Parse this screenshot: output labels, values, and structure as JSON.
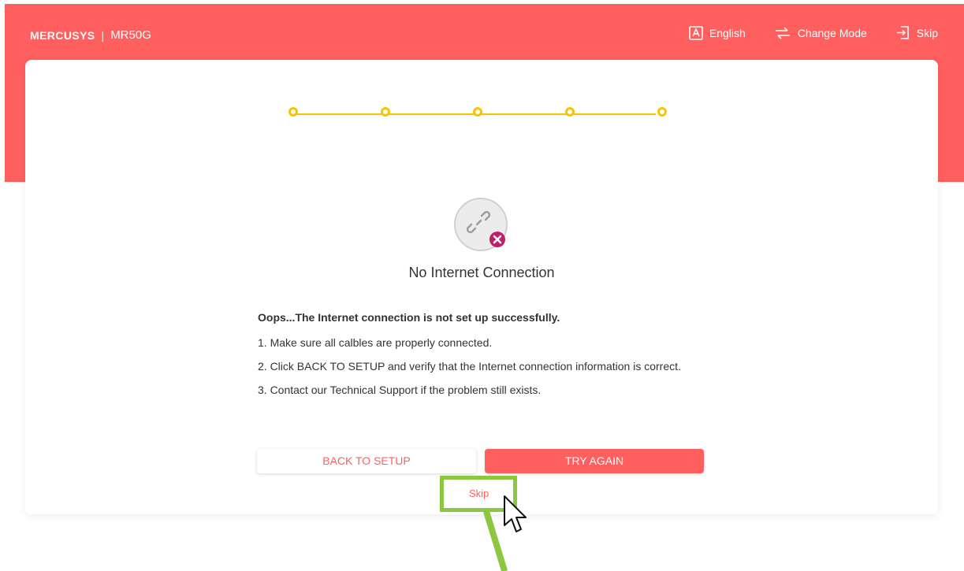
{
  "header": {
    "brand": "MERCUSYS",
    "separator": "|",
    "model": "MR50G",
    "nav": {
      "language": {
        "label": "English",
        "icon": "language-icon"
      },
      "change_mode": {
        "label": "Change Mode",
        "icon": "change-mode-icon"
      },
      "skip": {
        "label": "Skip",
        "icon": "skip-icon"
      }
    }
  },
  "wizard": {
    "steps": [
      {
        "name": "step-1"
      },
      {
        "name": "step-2"
      },
      {
        "name": "step-3"
      },
      {
        "name": "step-4"
      },
      {
        "name": "step-5"
      }
    ]
  },
  "status": {
    "icon": "broken-link-icon",
    "title": "No Internet Connection"
  },
  "message": {
    "headline": "Oops...The Internet connection is not set up successfully.",
    "items": [
      "1. Make sure all calbles are properly connected.",
      "2. Click BACK TO SETUP and verify that the Internet connection information is correct.",
      "3. Contact our Technical Support if the problem still exists."
    ]
  },
  "actions": {
    "back_to_setup": "BACK TO SETUP",
    "try_again": "TRY AGAIN",
    "skip": "Skip"
  },
  "colors": {
    "brand": "#ff5f5f",
    "step": "#f6c400",
    "annotation": "#8dc63f",
    "error": "#c01d6a"
  }
}
